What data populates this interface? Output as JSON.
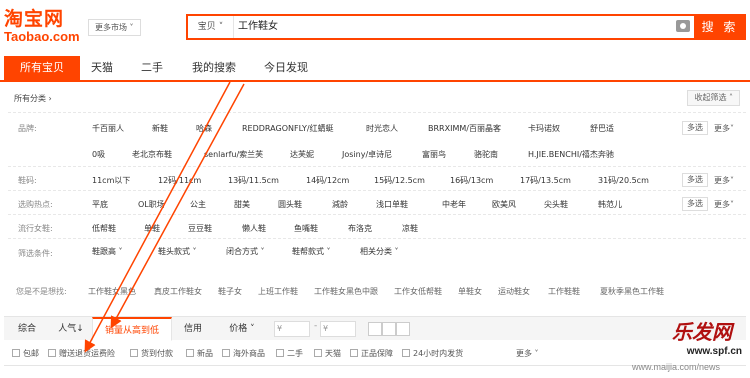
{
  "header": {
    "logo_main": "淘宝网",
    "logo_sub": "Taobao.com",
    "market_label": "更多市场",
    "search_scope": "宝贝",
    "search_value": "工作鞋女",
    "search_button": "搜 索"
  },
  "nav": {
    "tabs": [
      {
        "label": "所有宝贝",
        "active": true
      },
      {
        "label": "天猫",
        "active": false
      },
      {
        "label": "二手",
        "active": false
      },
      {
        "label": "我的搜索",
        "active": false
      },
      {
        "label": "今日发现",
        "active": false
      }
    ]
  },
  "filters": {
    "breadcrumb": "所有分类",
    "collapse": "收起筛选",
    "multi_label": "多选",
    "more_label": "更多",
    "brand": {
      "label": "品牌:",
      "row1": [
        "千百丽人",
        "新鞋",
        "哈森",
        "REDDRAGONFLY/红蜻蜓",
        "时光恋人",
        "BRRXIMM/百丽晶客",
        "卡玛诺奴",
        "舒巴适"
      ],
      "row2": [
        "0吸",
        "老北京布鞋",
        "senlarfu/索兰芙",
        "达芙妮",
        "Josiny/卓诗尼",
        "富丽鸟",
        "骆驼南",
        "H.JIE.BENCHI/禧杰奔驰"
      ]
    },
    "size": {
      "label": "鞋码:",
      "options": [
        "11cm以下",
        "12码/11cm",
        "13码/11.5cm",
        "14码/12cm",
        "15码/12.5cm",
        "16码/13cm",
        "17码/13.5cm",
        "31码/20.5cm"
      ]
    },
    "hot": {
      "label": "选购热点:",
      "options": [
        "平底",
        "OL职场",
        "公主",
        "甜美",
        "圆头鞋",
        "減龄",
        "浅口单鞋",
        "中老年",
        "欧美风",
        "尖头鞋",
        "韩范儿"
      ]
    },
    "popular": {
      "label": "流行女鞋:",
      "options": [
        "低帮鞋",
        "单鞋",
        "豆豆鞋",
        "懒人鞋",
        "鱼嘴鞋",
        "布洛克",
        "凉鞋"
      ]
    },
    "conditions": {
      "label": "筛选条件:",
      "options": [
        "鞋跟高",
        "鞋头款式",
        "闭合方式",
        "鞋帮款式",
        "相关分类"
      ]
    }
  },
  "suggestions": {
    "label": "您是不是想找:",
    "items": [
      "工作鞋女黑色",
      "真皮工作鞋女",
      "鞋子女",
      "上班工作鞋",
      "工作鞋女黑色中跟",
      "工作女低帮鞋",
      "单鞋女",
      "运动鞋女",
      "工作鞋鞋",
      "夏秋季黑色工作鞋"
    ]
  },
  "sortbar": {
    "tabs": [
      "综合",
      "人气",
      "销量从高到低",
      "信用",
      "价格"
    ],
    "active_index": 2,
    "price_from_placeholder": "¥",
    "price_to_placeholder": "¥",
    "price_dash": "-"
  },
  "checkboxes": [
    "包邮",
    "赠送退货运费险",
    "货到付款",
    "新品",
    "海外商品",
    "二手",
    "天猫",
    "正品保障",
    "24小时内发货"
  ],
  "checkbox_more": "更多",
  "watermark": {
    "title": "乐发网",
    "url": "www.spf.cn",
    "url2": "www.maijia.com/news"
  },
  "colors": {
    "accent": "#ff4400",
    "arrow": "#ff4400"
  }
}
